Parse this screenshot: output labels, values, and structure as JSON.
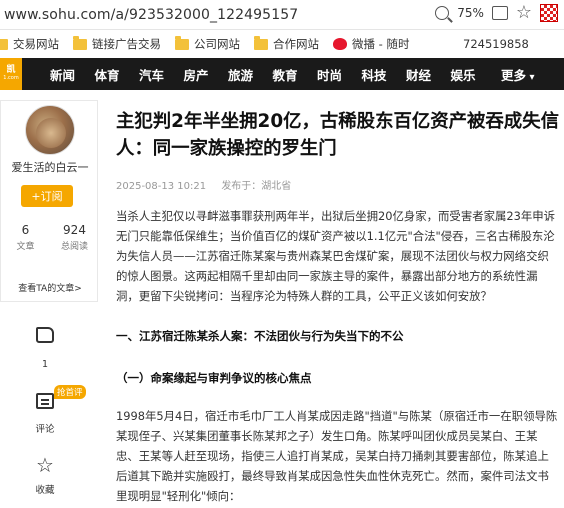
{
  "browser": {
    "url": "www.sohu.com/a/923532000_122495157",
    "zoom": "75%"
  },
  "bookmarks": {
    "items": [
      "交易网站",
      "链接广告交易",
      "公司网站",
      "合作网站",
      "微播 - 随时"
    ],
    "number": "724519858"
  },
  "nav": {
    "logo_top": "凯",
    "logo_bottom": "1.com",
    "items": [
      "新闻",
      "体育",
      "汽车",
      "房产",
      "旅游",
      "教育",
      "时尚",
      "科技",
      "财经",
      "娱乐"
    ],
    "more": "更多"
  },
  "author": {
    "name": "爱生活的白云一",
    "follow": "+订阅",
    "articles_count": "6",
    "articles_label": "文章",
    "reads_count": "924",
    "reads_label": "总阅读",
    "see_all": "查看TA的文章>"
  },
  "side_actions": {
    "like_count": "1",
    "comment_badge": "抢首评",
    "comment_label": "评论",
    "favorite_label": "收藏"
  },
  "article": {
    "title": "主犯判2年半坐拥20亿，古稀股东百亿资产被吞成失信人：同一家族操控的罗生门",
    "date": "2025-08-13 10:21",
    "source": "发布于：湖北省",
    "intro": "当杀人主犯仅以寻衅滋事罪获刑两年半，出狱后坐拥20亿身家，而受害者家属23年申诉无门只能靠低保维生；当价值百亿的煤矿资产被以1.1亿元\"合法\"侵吞，三名古稀股东沦为失信人员——江苏宿迁陈某案与贵州森某巴舍煤矿案，展现不法团伙与权力网络交织的惊人图景。这两起相隔千里却由同一家族主导的案件，暴露出部分地方的系统性漏洞，更留下尖锐拷问：当程序沦为特殊人群的工具，公平正义该如何安放？",
    "section1": "一、江苏宿迁陈某杀人案：不法团伙与行为失当下的不公",
    "subsection1": "（一）命案缘起与审判争议的核心焦点",
    "para2": "1998年5月4日，宿迁市毛巾厂工人肖某成因走路\"挡道\"与陈某（原宿迁市一在职领导陈某现侄子、兴某集团董事长陈某邦之子）发生口角。陈某呼叫团伙成员吴某白、王某忠、王某等人赶至现场，指使三人追打肖某成，吴某白持刀捅刺其要害部位，陈某追上后道其下跪并实施殴打，最终导致肖某成因急性失血性休克死亡。然而，案件司法文书里现明显\"轻刑化\"倾向："
  }
}
